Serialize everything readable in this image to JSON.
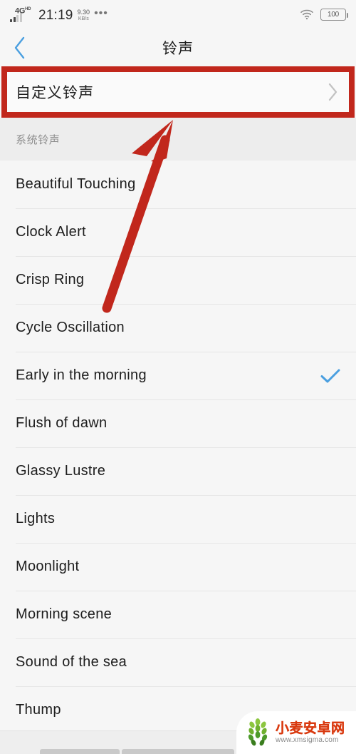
{
  "status_bar": {
    "network": "4G",
    "network_sup": "HD",
    "time": "21:19",
    "speed_value": "9.30",
    "speed_unit": "KB/s",
    "overflow": "•••",
    "wifi_icon": "wifi-icon",
    "battery_level": "100"
  },
  "header": {
    "back_icon": "chevron-left-icon",
    "title": "铃声"
  },
  "custom_row": {
    "label": "自定义铃声",
    "chevron_icon": "chevron-right-icon",
    "highlight_color": "#c1271c"
  },
  "section": {
    "header": "系统铃声"
  },
  "ringtones": [
    {
      "name": "Beautiful Touching",
      "selected": false
    },
    {
      "name": "Clock Alert",
      "selected": false
    },
    {
      "name": "Crisp Ring",
      "selected": false
    },
    {
      "name": "Cycle Oscillation",
      "selected": false
    },
    {
      "name": "Early in the morning",
      "selected": true
    },
    {
      "name": "Flush of dawn",
      "selected": false
    },
    {
      "name": "Glassy Lustre",
      "selected": false
    },
    {
      "name": "Lights",
      "selected": false
    },
    {
      "name": "Moonlight",
      "selected": false
    },
    {
      "name": "Morning scene",
      "selected": false
    },
    {
      "name": "Sound of the sea",
      "selected": false
    },
    {
      "name": "Thump",
      "selected": false
    }
  ],
  "annotation": {
    "arrow_icon": "arrow-up-right-icon",
    "arrow_color": "#c1271c"
  },
  "colors": {
    "accent_blue": "#4a9fe0",
    "annotation_red": "#c1271c",
    "background": "#f6f6f6"
  },
  "watermark": {
    "logo_icon": "wheat-logo-icon",
    "site_name": "小麦安卓网",
    "site_url": "www.xmsigma.com"
  },
  "nav_bar": {
    "items": [
      "recents-bar",
      "home-bar",
      "back-bar"
    ]
  }
}
